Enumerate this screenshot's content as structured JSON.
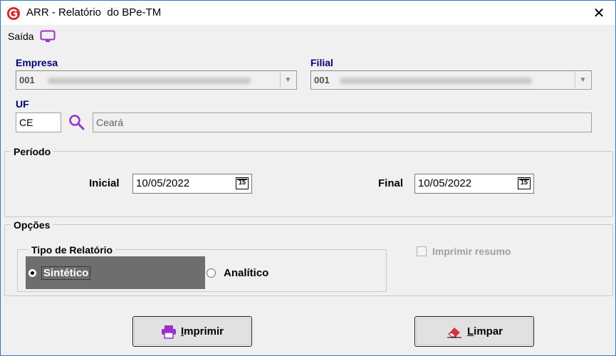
{
  "window": {
    "title": "ARR - Relatório  do BPe-TM",
    "close_glyph": "✕"
  },
  "menu": {
    "saida_label": "Saída",
    "saida_icon": "monitor-icon"
  },
  "empresa": {
    "label": "Empresa",
    "value": "001"
  },
  "filial": {
    "label": "Filial",
    "value": "001"
  },
  "uf": {
    "label": "UF",
    "code": "CE",
    "name": "Ceará"
  },
  "periodo": {
    "title": "Período",
    "inicial_label": "Inicial",
    "inicial_value": "10/05/2022",
    "final_label": "Final",
    "final_value": "10/05/2022",
    "calendar_day": "15"
  },
  "opcoes": {
    "title": "Opções",
    "tipo_title": "Tipo de Relatório",
    "sintetico_label": "Sintético",
    "analitico_label": "Analítico",
    "selected": "Sintético",
    "imprimir_resumo_label": "Imprimir resumo",
    "imprimir_resumo_checked": false,
    "imprimir_resumo_enabled": false
  },
  "buttons": {
    "imprimir_first": "I",
    "imprimir_rest": "mprimir",
    "limpar_first": "L",
    "limpar_rest": "impar"
  },
  "colors": {
    "label_blue": "#000080",
    "accent_purple": "#9b30d0",
    "border_blue": "#2b7bd6"
  }
}
